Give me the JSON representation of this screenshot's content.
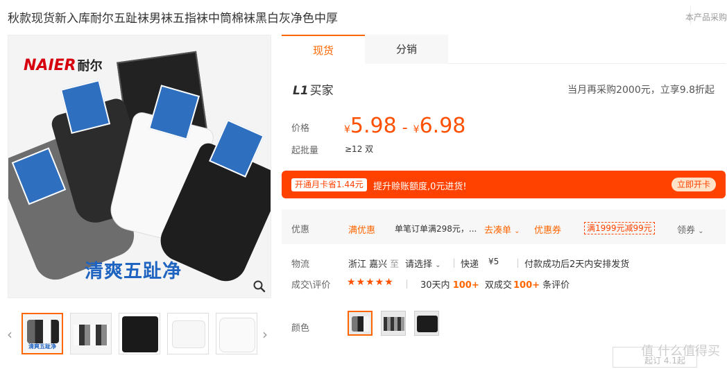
{
  "title": "秋款现货新入库耐尔五趾袜男袜五指袜中筒棉袜黑白灰净色中厚",
  "source_note": "本产品采购",
  "main_image": {
    "brand_latin": "NAIER",
    "brand_cn": "耐尔",
    "slogan": "清爽五趾净"
  },
  "thumbnails": [
    {
      "caption": "清爽五趾净"
    },
    {
      "caption": ""
    },
    {
      "caption": ""
    },
    {
      "caption": ""
    },
    {
      "caption": ""
    }
  ],
  "tabs": [
    {
      "label": "现货"
    },
    {
      "label": "分销"
    }
  ],
  "buyer": {
    "level": "L1",
    "label": "买家",
    "note": "当月再采购2000元，立享9.8折起"
  },
  "price": {
    "label": "价格",
    "currency": "¥",
    "low": "5.98",
    "dash": "-",
    "high": "6.98",
    "moq_label": "起批量",
    "moq_value": "≥12 双"
  },
  "promo": {
    "chip": "开通月卡省1.44元",
    "text": "提升赊账额度,0元进货!",
    "button": "立即开卡"
  },
  "coupon": {
    "label": "优惠",
    "item1": "满优惠",
    "item2": "单笔订单满298元，...",
    "item3": "去凑单",
    "item4": "优惠券",
    "item5": "满1999元减99元",
    "item6": "领券"
  },
  "logistics": {
    "label": "物流",
    "from": "浙江 嘉兴",
    "to_word": "至",
    "select": "请选择",
    "method": "快递",
    "fee": "¥5",
    "note": "付款成功后2天内安排发货"
  },
  "reviews": {
    "label": "成交\\评价",
    "stars": "★★★★★",
    "days": "30天内",
    "count1": "100+",
    "count1_suffix": "双成交",
    "count2": "100+",
    "count2_suffix": "条评价"
  },
  "color": {
    "label": "颜色"
  },
  "watermark": {
    "main": "值 什么值得买",
    "sub": "起订 4.1起"
  },
  "colors": {
    "accent": "#ff6600",
    "price": "#ff5000",
    "promo_bg": "#ff4200"
  }
}
